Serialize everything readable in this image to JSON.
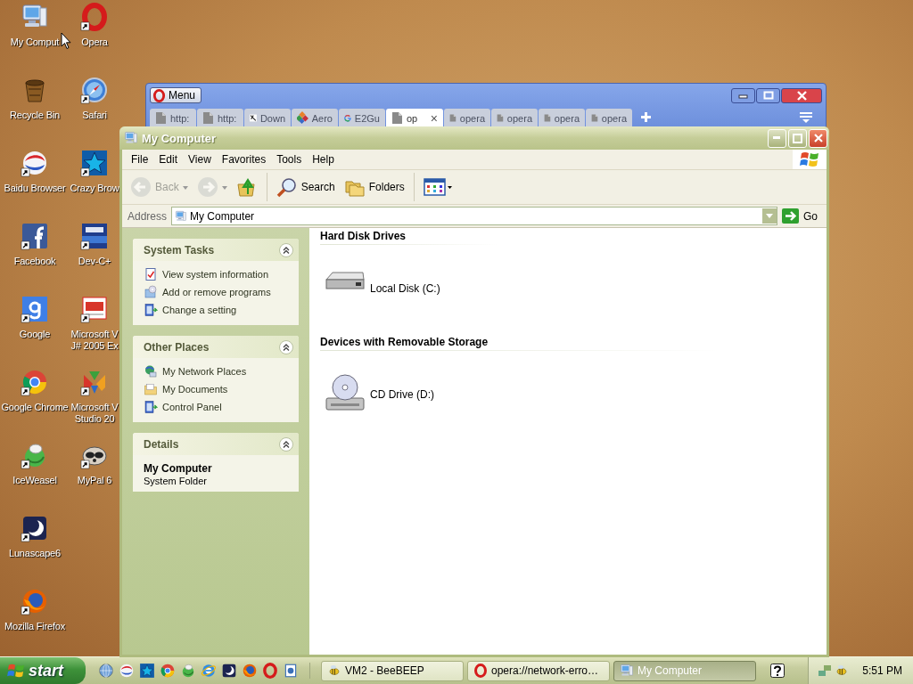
{
  "desktop_icons": [
    {
      "label": "My Comput",
      "kind": "computer",
      "shortcut": false
    },
    {
      "label": "Opera",
      "kind": "ring",
      "shortcut": true
    },
    {
      "label": "Recycle Bin",
      "kind": "bin",
      "shortcut": false
    },
    {
      "label": "Safari",
      "kind": "compass",
      "shortcut": true
    },
    {
      "label": "Baidu Browser",
      "kind": "swirl",
      "shortcut": true
    },
    {
      "label": "Crazy Brow",
      "kind": "star",
      "shortcut": true
    },
    {
      "label": "Facebook",
      "kind": "ftile",
      "shortcut": true
    },
    {
      "label": "Dev-C+",
      "kind": "devtile",
      "shortcut": true
    },
    {
      "label": "Google",
      "kind": "gtile",
      "shortcut": true
    },
    {
      "label": "Microsoft V\nJ# 2005 Ex",
      "kind": "vjtile",
      "shortcut": true
    },
    {
      "label": "Google Chrome",
      "kind": "chrome",
      "shortcut": true
    },
    {
      "label": "Microsoft V\nStudio 20",
      "kind": "vs",
      "shortcut": true
    },
    {
      "label": "IceWeasel",
      "kind": "weasel",
      "shortcut": true
    },
    {
      "label": "MyPal 6",
      "kind": "raccoon",
      "shortcut": true
    },
    {
      "label": "Lunascape6",
      "kind": "moon",
      "shortcut": true
    },
    {
      "label": "Mozilla Firefox",
      "kind": "firefox",
      "shortcut": true
    }
  ],
  "browser": {
    "menu_button": "Menu",
    "tabs": [
      {
        "label": "http:",
        "selected": false,
        "kind": "page"
      },
      {
        "label": "http:",
        "selected": false,
        "kind": "page"
      },
      {
        "label": "Down",
        "selected": false,
        "kind": "hammer"
      },
      {
        "label": "Aero",
        "selected": false,
        "kind": "diamond"
      },
      {
        "label": "E2Gu",
        "selected": false,
        "kind": "g"
      },
      {
        "label": "op",
        "selected": true,
        "kind": "page",
        "close": "×"
      },
      {
        "label": "opera",
        "selected": false,
        "kind": "page"
      },
      {
        "label": "opera",
        "selected": false,
        "kind": "page"
      },
      {
        "label": "opera",
        "selected": false,
        "kind": "page"
      },
      {
        "label": "opera",
        "selected": false,
        "kind": "page"
      }
    ]
  },
  "explorer": {
    "title": "My Computer",
    "menu": [
      "File",
      "Edit",
      "View",
      "Favorites",
      "Tools",
      "Help"
    ],
    "toolbar": [
      {
        "kind": "back",
        "label": "Back",
        "disabled": true
      },
      {
        "kind": "forward",
        "disabled": true
      },
      {
        "kind": "up",
        "disabled": false
      },
      {
        "kind": "search",
        "label": "Search",
        "disabled": false
      },
      {
        "kind": "folders",
        "label": "Folders",
        "disabled": false
      },
      {
        "kind": "views",
        "disabled": false
      }
    ],
    "address": {
      "label": "Address",
      "value": "My Computer",
      "go": "Go"
    },
    "panels": [
      {
        "title": "System Tasks",
        "expanded": true,
        "items": [
          {
            "label": "View system information",
            "kind": "info"
          },
          {
            "label": "Add or remove programs",
            "kind": "programs"
          },
          {
            "label": "Change a setting",
            "kind": "setting"
          }
        ]
      },
      {
        "title": "Other Places",
        "expanded": true,
        "items": [
          {
            "label": "My Network Places",
            "kind": "network"
          },
          {
            "label": "My Documents",
            "kind": "documents"
          },
          {
            "label": "Control Panel",
            "kind": "setting"
          }
        ]
      },
      {
        "title": "Details",
        "expanded": true,
        "details": {
          "name": "My Computer",
          "type": "System Folder"
        }
      }
    ],
    "groups": [
      {
        "title": "Hard Disk Drives",
        "items": [
          {
            "label": "Local Disk (C:)",
            "kind": "disk"
          }
        ]
      },
      {
        "title": "Devices with Removable Storage",
        "items": [
          {
            "label": "CD Drive (D:)",
            "kind": "cd"
          }
        ]
      }
    ]
  },
  "taskbar": {
    "start": "start",
    "tasks": [
      {
        "label": "VM2 - BeeBEEP",
        "selected": false,
        "kind": "bee"
      },
      {
        "label": "opera://network-erro…",
        "selected": false,
        "kind": "ring"
      },
      {
        "label": "My Computer",
        "selected": true,
        "kind": "computer"
      }
    ],
    "clock": "5:51 PM"
  }
}
